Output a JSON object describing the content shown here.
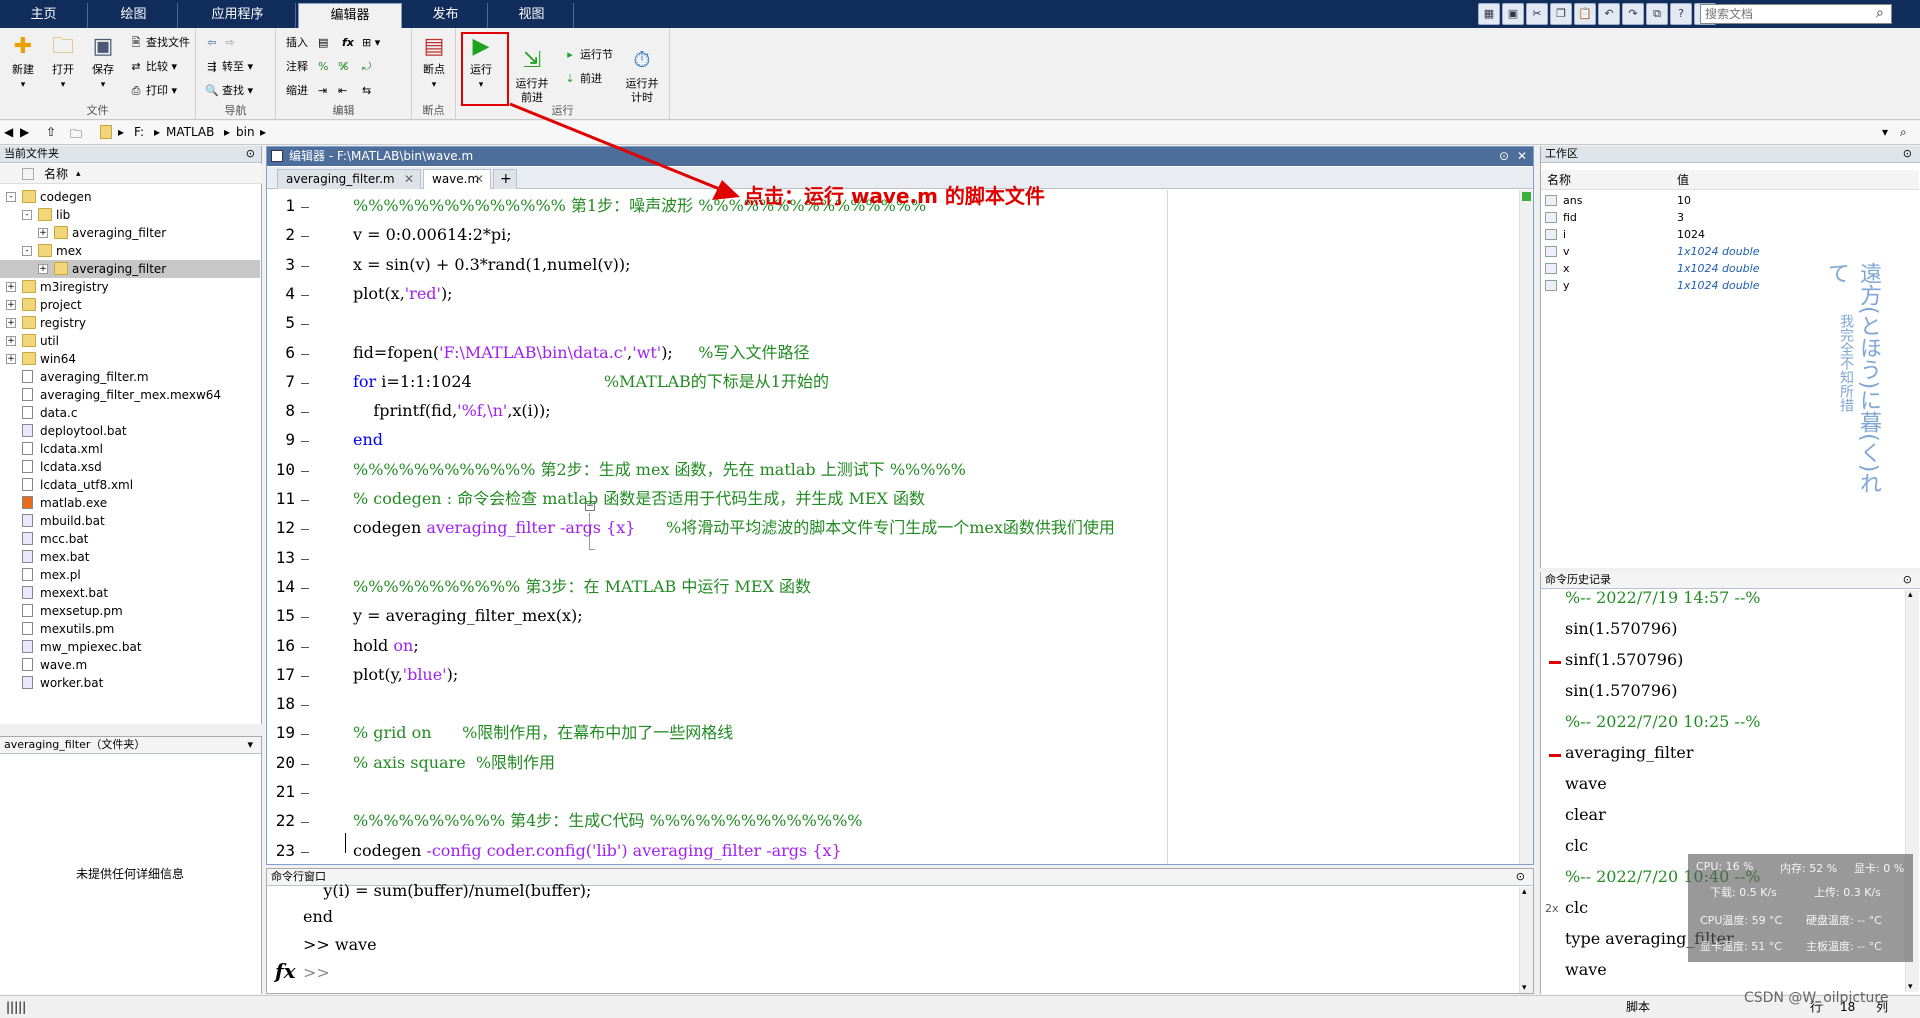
{
  "ribbon_tabs": [
    "主页",
    "绘图",
    "应用程序",
    "编辑器",
    "发布",
    "视图"
  ],
  "search_placeholder": "搜索文档",
  "groups": {
    "file": {
      "label": "文件",
      "new": "新建",
      "open": "打开",
      "save": "保存",
      "find_files": "查找文件",
      "compare": "比较",
      "print": "打印"
    },
    "nav": {
      "label": "导航",
      "goto": "转至",
      "find": "查找"
    },
    "edit": {
      "label": "编辑",
      "insert": "插入",
      "comment": "注释",
      "indent": "缩进",
      "fx": "fx"
    },
    "breakpoint": {
      "label": "断点",
      "breakpoints": "断点"
    },
    "run": {
      "label": "运行",
      "run": "运行",
      "run_advance": "运行并\n前进",
      "run_section": "运行节",
      "advance": "前进",
      "run_time": "运行并\n计时"
    }
  },
  "address": {
    "drive": "F:",
    "parts": [
      "MATLAB",
      "bin"
    ]
  },
  "current_folder": {
    "title": "当前文件夹",
    "header": "名称",
    "items": [
      {
        "name": "codegen",
        "type": "folder",
        "expand": "-",
        "depth": 0
      },
      {
        "name": "lib",
        "type": "folder",
        "expand": "-",
        "depth": 1
      },
      {
        "name": "averaging_filter",
        "type": "folder",
        "expand": "+",
        "depth": 2
      },
      {
        "name": "mex",
        "type": "folder",
        "expand": "-",
        "depth": 1
      },
      {
        "name": "averaging_filter",
        "type": "folder",
        "expand": "+",
        "depth": 2,
        "selected": true
      },
      {
        "name": "m3iregistry",
        "type": "folder",
        "expand": "+",
        "depth": 0
      },
      {
        "name": "project",
        "type": "folder",
        "expand": "+",
        "depth": 0
      },
      {
        "name": "registry",
        "type": "folder",
        "expand": "+",
        "depth": 0
      },
      {
        "name": "util",
        "type": "folder",
        "expand": "+",
        "depth": 0
      },
      {
        "name": "win64",
        "type": "folder",
        "expand": "+",
        "depth": 0
      },
      {
        "name": "averaging_filter.m",
        "type": "m"
      },
      {
        "name": "averaging_filter_mex.mexw64",
        "type": "file"
      },
      {
        "name": "data.c",
        "type": "file"
      },
      {
        "name": "deploytool.bat",
        "type": "bat"
      },
      {
        "name": "lcdata.xml",
        "type": "xml"
      },
      {
        "name": "lcdata.xsd",
        "type": "xml"
      },
      {
        "name": "lcdata_utf8.xml",
        "type": "xml"
      },
      {
        "name": "matlab.exe",
        "type": "exe"
      },
      {
        "name": "mbuild.bat",
        "type": "bat"
      },
      {
        "name": "mcc.bat",
        "type": "bat"
      },
      {
        "name": "mex.bat",
        "type": "bat"
      },
      {
        "name": "mex.pl",
        "type": "file"
      },
      {
        "name": "mexext.bat",
        "type": "bat"
      },
      {
        "name": "mexsetup.pm",
        "type": "file"
      },
      {
        "name": "mexutils.pm",
        "type": "file"
      },
      {
        "name": "mw_mpiexec.bat",
        "type": "bat"
      },
      {
        "name": "wave.m",
        "type": "m"
      },
      {
        "name": "worker.bat",
        "type": "bat"
      }
    ]
  },
  "details": {
    "title": "averaging_filter（文件夹）",
    "empty_text": "未提供任何详细信息"
  },
  "editor": {
    "title": "编辑器 - F:\\MATLAB\\bin\\wave.m",
    "tabs": [
      "averaging_filter.m",
      "wave.m"
    ],
    "active_tab": 1,
    "line_numbers": [
      "1",
      "2",
      "3",
      "4",
      "5",
      "6",
      "7",
      "8",
      "9",
      "10",
      "11",
      "12",
      "13",
      "14",
      "15",
      "16",
      "17",
      "18",
      "19",
      "20",
      "21",
      "22",
      "23"
    ],
    "code": [
      [
        {
          "t": "%%%%%%%%%%%%%% 第1步：噪声波形 %%%%%%%%%%%%%%%",
          "c": "cm"
        }
      ],
      [
        {
          "t": "v = 0:0.00614:2*pi;",
          "c": ""
        }
      ],
      [
        {
          "t": "x = sin(v) + 0.3*rand(1,numel(v));",
          "c": ""
        }
      ],
      [
        {
          "t": "plot(x,",
          "c": ""
        },
        {
          "t": "'red'",
          "c": "st"
        },
        {
          "t": ");",
          "c": ""
        }
      ],
      [],
      [
        {
          "t": "fid=fopen(",
          "c": ""
        },
        {
          "t": "'F:\\MATLAB\\bin\\data.c'",
          "c": "st"
        },
        {
          "t": ",",
          "c": ""
        },
        {
          "t": "'wt'",
          "c": "st"
        },
        {
          "t": ");     ",
          "c": ""
        },
        {
          "t": "%写入文件路径",
          "c": "cm"
        }
      ],
      [
        {
          "t": "for",
          "c": "kw"
        },
        {
          "t": " i=1:1:1024                          ",
          "c": ""
        },
        {
          "t": "%MATLAB的下标是从1开始的",
          "c": "cm"
        }
      ],
      [
        {
          "t": "    fprintf(fid,",
          "c": ""
        },
        {
          "t": "'%f,\\n'",
          "c": "st"
        },
        {
          "t": ",x(i));",
          "c": ""
        }
      ],
      [
        {
          "t": "end",
          "c": "kw"
        }
      ],
      [
        {
          "t": "%%%%%%%%%%%% 第2步：生成 mex 函数，先在 matlab 上测试下 %%%%%",
          "c": "cm"
        }
      ],
      [
        {
          "t": "% codegen : 命令会检查 matlab 函数是否适用于代码生成，并生成 MEX 函数",
          "c": "cm"
        }
      ],
      [
        {
          "t": "codegen ",
          "c": ""
        },
        {
          "t": "averaging_filter -args {x}",
          "c": "st"
        },
        {
          "t": "      ",
          "c": ""
        },
        {
          "t": "%将滑动平均滤波的脚本文件专门生成一个mex函数供我们使用",
          "c": "cm"
        }
      ],
      [],
      [
        {
          "t": "%%%%%%%%%%% 第3步：在 MATLAB 中运行 MEX 函数",
          "c": "cm"
        }
      ],
      [
        {
          "t": "y = averaging_filter_mex(x);",
          "c": ""
        }
      ],
      [
        {
          "t": "hold ",
          "c": ""
        },
        {
          "t": "on",
          "c": "st"
        },
        {
          "t": ";",
          "c": ""
        }
      ],
      [
        {
          "t": "plot(y,",
          "c": ""
        },
        {
          "t": "'blue'",
          "c": "st"
        },
        {
          "t": ");",
          "c": ""
        }
      ],
      [],
      [
        {
          "t": "% grid on      %限制作用，在幕布中加了一些网格线",
          "c": "cm"
        }
      ],
      [
        {
          "t": "% axis square  %限制作用",
          "c": "cm"
        }
      ],
      [],
      [
        {
          "t": "%%%%%%%%%% 第4步：生成C代码 %%%%%%%%%%%%%%",
          "c": "cm"
        }
      ],
      [
        {
          "t": "codegen ",
          "c": ""
        },
        {
          "t": "-config coder.config('lib') averaging_filter -args {x}",
          "c": "st"
        }
      ]
    ]
  },
  "command_window": {
    "title": "命令行窗口",
    "lines": [
      "    y(i) = sum(buffer)/numel(buffer);",
      "end",
      ">> wave"
    ],
    "prompt": ">>",
    "fx": "fx"
  },
  "workspace": {
    "title": "工作区",
    "col_name": "名称",
    "col_value": "值",
    "vars": [
      {
        "name": "ans",
        "value": "10",
        "italic": false
      },
      {
        "name": "fid",
        "value": "3",
        "italic": false
      },
      {
        "name": "i",
        "value": "1024",
        "italic": false
      },
      {
        "name": "v",
        "value": "1x1024 double",
        "italic": true
      },
      {
        "name": "x",
        "value": "1x1024 double",
        "italic": true
      },
      {
        "name": "y",
        "value": "1x1024 double",
        "italic": true
      }
    ]
  },
  "history": {
    "title": "命令历史记录",
    "entries": [
      {
        "text": "%-- 2022/7/19 14:57 --%",
        "sep": true,
        "mark": false
      },
      {
        "text": "sin(1.570796)",
        "sep": false,
        "mark": false
      },
      {
        "text": "sinf(1.570796)",
        "sep": false,
        "mark": true
      },
      {
        "text": "sin(1.570796)",
        "sep": false,
        "mark": false
      },
      {
        "text": "%-- 2022/7/20 10:25 --%",
        "sep": true,
        "mark": false
      },
      {
        "text": "averaging_filter",
        "sep": false,
        "mark": true
      },
      {
        "text": "wave",
        "sep": false,
        "mark": false
      },
      {
        "text": "clear",
        "sep": false,
        "mark": false
      },
      {
        "text": "clc",
        "sep": false,
        "mark": false
      },
      {
        "text": "%-- 2022/7/20 10:40 --%",
        "sep": true,
        "mark": false
      },
      {
        "text": "clc",
        "sep": false,
        "mark": false,
        "count": "2x"
      },
      {
        "text": "type averaging_filter",
        "sep": false,
        "mark": false
      },
      {
        "text": "wave",
        "sep": false,
        "mark": false
      }
    ]
  },
  "annotation": "点击：运行 wave.m 的脚本文件",
  "status": {
    "mode": "脚本",
    "row_label": "行",
    "row": "18",
    "col_label": "列"
  },
  "sysmon": {
    "cpu": "CPU: 16 %",
    "mem": "内存: 52 %",
    "gpu": "显卡: 0 %",
    "down": "下载: 0.5 K/s",
    "up": "上传: 0.3 K/s",
    "cpu_temp": "CPU温度: 59 °C",
    "disk_temp": "硬盘温度: -- °C",
    "gpu_temp": "显卡温度: 51 °C",
    "board_temp": "主板温度: -- °C"
  },
  "overlay_jp": "遠方(とほう)に暮(く)れて",
  "overlay_jp2": "我完全不知所措",
  "watermark": "CSDN @W_oilpicture",
  "colors": {
    "comment": "#228b22",
    "string": "#a020f0",
    "keyword": "#0000ff",
    "annotation": "#e00000",
    "tabbar": "#102d5c"
  }
}
